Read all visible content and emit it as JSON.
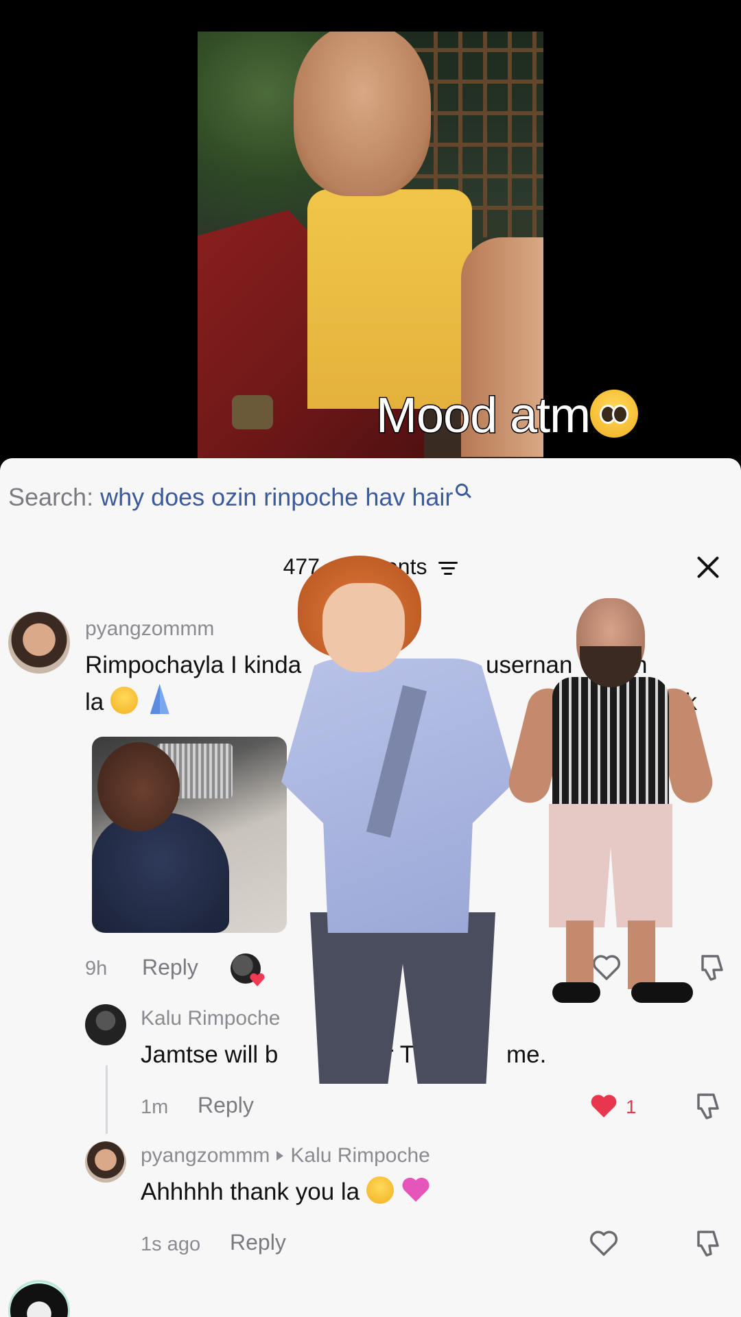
{
  "video": {
    "caption": "Mood atm",
    "caption_emoji": "pleading-face-emoji"
  },
  "search": {
    "label": "Search:",
    "query": "why does ozin rinpoche hav hair"
  },
  "comments_header": {
    "count_label": "477 comments"
  },
  "comments": [
    {
      "username": "pyangzommm",
      "text": "Rimpochayla I kinda want your username on Tiktok la",
      "text_visible_left": "Rimpochayla I kinda",
      "text_visible_right": "usernan",
      "text_visible_end": "n Tiktok",
      "text_line2": "la",
      "emojis": [
        "pleading-face-emoji",
        "folded-hands-emoji"
      ],
      "has_gif": true,
      "time": "9h",
      "reply_label": "Reply",
      "likes": "1",
      "liked": false
    },
    {
      "username": "Kalu Rimpoche",
      "creator_tag": "tor",
      "text_left": "Jamtse will b",
      "text_mid": "r TikTo",
      "text_end": "me.",
      "time": "1m",
      "reply_label": "Reply",
      "likes": "1",
      "liked": true
    },
    {
      "username": "pyangzommm",
      "reply_to": "Kalu Rimpoche",
      "text": "Ahhhhh thank you la",
      "emojis": [
        "melting-face-emoji",
        "pink-heart-emoji"
      ],
      "time": "1s ago",
      "reply_label": "Reply",
      "likes": "",
      "liked": false
    }
  ],
  "colors": {
    "like_red": "#e8364f",
    "link_blue": "#3b5a9c",
    "creator_teal": "#2fa6b5"
  }
}
